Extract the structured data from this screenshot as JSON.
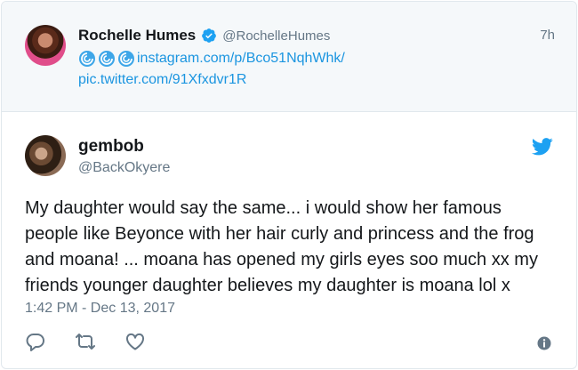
{
  "quoted_tweet": {
    "name": "Rochelle Humes",
    "handle": "@RochelleHumes",
    "time": "7h",
    "link_text": "instagram.com/p/Bco51NqhWhk/",
    "media_link": "pic.twitter.com/91Xfxdvr1R",
    "emoji_icons": [
      "cyclone-icon",
      "cyclone-icon",
      "cyclone-icon"
    ]
  },
  "tweet": {
    "name": "gembob",
    "handle": "@BackOkyere",
    "text_lines": [
      "My daughter would say the same... i would show her famous",
      "people like Beyonce with her hair curly and princess and the frog",
      "and moana! ... moana has opened my girls eyes soo much xx my",
      "friends younger daughter believes my daughter is moana lol x"
    ],
    "timestamp": "1:42 PM - Dec 13, 2017"
  },
  "colors": {
    "link": "#1b95e0",
    "secondary_text": "#657786",
    "icon": "#657786",
    "verified": "#1da1f2",
    "brand": "#1da1f2"
  },
  "actions": [
    "reply-icon",
    "retweet-icon",
    "like-icon",
    "info-icon"
  ]
}
